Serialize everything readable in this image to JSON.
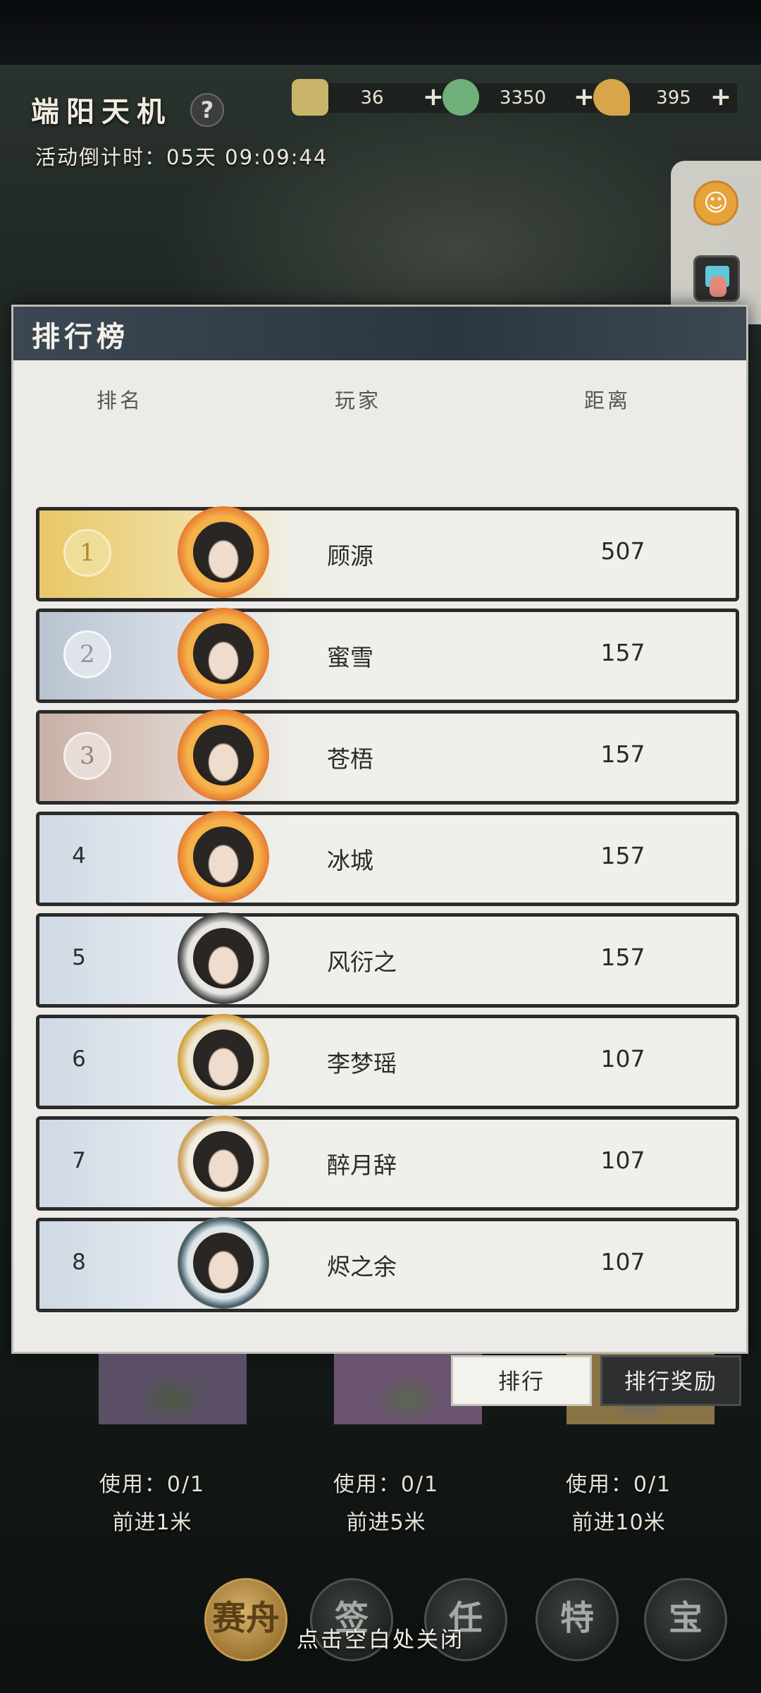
{
  "header": {
    "event_title": "端阳天机",
    "help_icon": "question-mark-icon",
    "countdown": "活动倒计时：05天 09:09:44"
  },
  "resources": [
    {
      "name": "scroll-token-icon",
      "value": "36",
      "plus": "+",
      "color": "#c9b56a"
    },
    {
      "name": "jade-coin-icon",
      "value": "3350",
      "plus": "+",
      "color": "#6fb07a"
    },
    {
      "name": "golden-key-icon",
      "value": "395",
      "plus": "+",
      "color": "#d9a54a"
    }
  ],
  "side_panel": {
    "accessibility_icon": "person-icon",
    "gesture_icon": "tap-hand-icon"
  },
  "leaderboard": {
    "title": "排行榜",
    "columns": {
      "rank": "排名",
      "player": "玩家",
      "distance": "距离"
    },
    "rows": [
      {
        "rank": "1",
        "player": "顾源",
        "distance": "507",
        "tier": "gold"
      },
      {
        "rank": "2",
        "player": "蜜雪",
        "distance": "157",
        "tier": "silver"
      },
      {
        "rank": "3",
        "player": "苍梧",
        "distance": "157",
        "tier": "bronze"
      },
      {
        "rank": "4",
        "player": "冰城",
        "distance": "157",
        "tier": "normal"
      },
      {
        "rank": "5",
        "player": "风衍之",
        "distance": "157",
        "tier": "normal"
      },
      {
        "rank": "6",
        "player": "李梦瑶",
        "distance": "107",
        "tier": "normal"
      },
      {
        "rank": "7",
        "player": "醉月辞",
        "distance": "107",
        "tier": "normal"
      },
      {
        "rank": "8",
        "player": "烬之余",
        "distance": "107",
        "tier": "normal"
      }
    ]
  },
  "tabs": {
    "rank": "排行",
    "reward": "排行奖励"
  },
  "items": [
    {
      "use": "使用：0/1",
      "advance": "前进1米"
    },
    {
      "use": "使用：0/1",
      "advance": "前进5米"
    },
    {
      "use": "使用：0/1",
      "advance": "前进10米"
    }
  ],
  "nav": [
    "赛舟",
    "签",
    "任",
    "特",
    "宝"
  ],
  "close_hint": "点击空白处关闭",
  "colors": {
    "gold": "#e8c766",
    "silver": "#b9c3d0",
    "bronze": "#c9b0a6",
    "row_wash": "#cfd9e4",
    "header_bg": "#2f3a44"
  }
}
